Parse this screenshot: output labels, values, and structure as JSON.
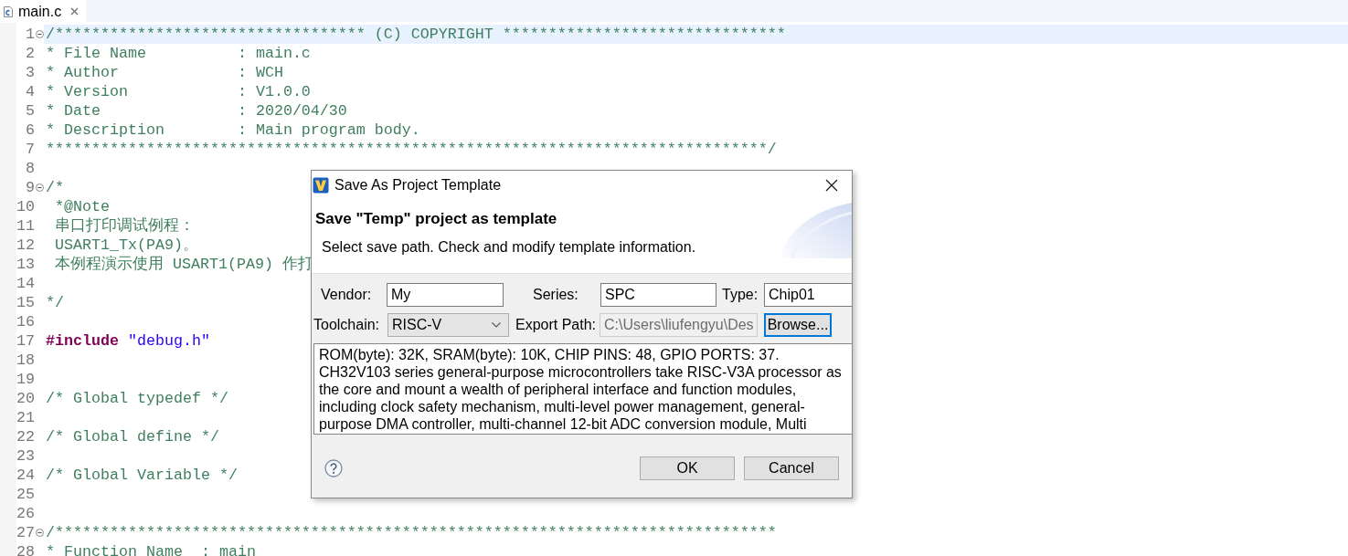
{
  "tabs": [
    {
      "label": "main.c",
      "selected": true
    }
  ],
  "editor": {
    "lines": [
      {
        "number": "1",
        "current": true,
        "collapsible": true,
        "segments": [
          {
            "kind": "comment",
            "text": "/********************************** (C) COPYRIGHT *******************************"
          }
        ]
      },
      {
        "number": "2",
        "current": false,
        "collapsible": false,
        "segments": [
          {
            "kind": "comment",
            "text": "* File Name          : main.c"
          }
        ]
      },
      {
        "number": "3",
        "current": false,
        "collapsible": false,
        "segments": [
          {
            "kind": "comment",
            "text": "* Author             : WCH"
          }
        ]
      },
      {
        "number": "4",
        "current": false,
        "collapsible": false,
        "segments": [
          {
            "kind": "comment",
            "text": "* Version            : V1.0.0"
          }
        ]
      },
      {
        "number": "5",
        "current": false,
        "collapsible": false,
        "segments": [
          {
            "kind": "comment",
            "text": "* Date               : 2020/04/30"
          }
        ]
      },
      {
        "number": "6",
        "current": false,
        "collapsible": false,
        "segments": [
          {
            "kind": "comment",
            "text": "* Description        : Main program body."
          }
        ]
      },
      {
        "number": "7",
        "current": false,
        "collapsible": false,
        "segments": [
          {
            "kind": "comment",
            "text": "*******************************************************************************/"
          }
        ]
      },
      {
        "number": "8",
        "current": false,
        "collapsible": false
      },
      {
        "number": "9",
        "current": false,
        "collapsible": true,
        "segments": [
          {
            "kind": "comment",
            "text": "/*"
          }
        ]
      },
      {
        "number": "10",
        "current": false,
        "collapsible": false,
        "segments": [
          {
            "kind": "comment",
            "text": " *@Note"
          }
        ]
      },
      {
        "number": "11",
        "current": false,
        "collapsible": false,
        "segments": [
          {
            "kind": "comment",
            "text": " 串口打印调试例程："
          }
        ]
      },
      {
        "number": "12",
        "current": false,
        "collapsible": false,
        "segments": [
          {
            "kind": "comment",
            "text": " USART1_Tx(PA9)。"
          }
        ]
      },
      {
        "number": "13",
        "current": false,
        "collapsible": false,
        "segments": [
          {
            "kind": "comment",
            "text": " 本例程演示使用 USART1(PA9) 作打"
          }
        ]
      },
      {
        "number": "14",
        "current": false,
        "collapsible": false
      },
      {
        "number": "15",
        "current": false,
        "collapsible": false,
        "segments": [
          {
            "kind": "comment",
            "text": "*/"
          }
        ]
      },
      {
        "number": "16",
        "current": false,
        "collapsible": false
      },
      {
        "number": "17",
        "current": false,
        "collapsible": false,
        "segments": [
          {
            "kind": "keyword",
            "text": "#include"
          },
          {
            "kind": "string",
            "text": " \"debug.h\""
          }
        ]
      },
      {
        "number": "18",
        "current": false,
        "collapsible": false
      },
      {
        "number": "19",
        "current": false,
        "collapsible": false
      },
      {
        "number": "20",
        "current": false,
        "collapsible": false,
        "segments": [
          {
            "kind": "comment",
            "text": "/* Global typedef */"
          }
        ]
      },
      {
        "number": "21",
        "current": false,
        "collapsible": false
      },
      {
        "number": "22",
        "current": false,
        "collapsible": false,
        "segments": [
          {
            "kind": "comment",
            "text": "/* Global define */"
          }
        ]
      },
      {
        "number": "23",
        "current": false,
        "collapsible": false
      },
      {
        "number": "24",
        "current": false,
        "collapsible": false,
        "segments": [
          {
            "kind": "comment",
            "text": "/* Global Variable */"
          }
        ]
      },
      {
        "number": "25",
        "current": false,
        "collapsible": false
      },
      {
        "number": "26",
        "current": false,
        "collapsible": false
      },
      {
        "number": "27",
        "current": false,
        "collapsible": true,
        "segments": [
          {
            "kind": "comment",
            "text": "/*******************************************************************************"
          }
        ]
      },
      {
        "number": "28",
        "current": false,
        "collapsible": false,
        "segments": [
          {
            "kind": "comment",
            "text": "* Function Name  : main"
          }
        ]
      }
    ]
  },
  "dialog": {
    "title": "Save As Project Template",
    "heading": "Save \"Temp\" project as template",
    "subtitle": "Select save path. Check and modify template information.",
    "fields_row_1": [
      {
        "kind": "text",
        "label": "Vendor:",
        "value": "My",
        "disabled": false
      },
      {
        "kind": "text",
        "label": "Series:",
        "value": "SPC",
        "disabled": false
      },
      {
        "kind": "text",
        "label": "Type:",
        "value": "Chip01",
        "disabled": false
      }
    ],
    "fields_row_2": [
      {
        "kind": "dropdown",
        "label": "Toolchain:",
        "value": "RISC-V",
        "disabled": false
      },
      {
        "kind": "text",
        "label": "Export Path:",
        "value": "C:\\Users\\liufengyu\\Des",
        "disabled": true
      }
    ],
    "browse_button": {
      "label": "Browse...",
      "focused": true
    },
    "description": [
      "ROM(byte): 32K, SRAM(byte): 10K, CHIP PINS: 48, GPIO PORTS: 37.",
      "CH32V103 series general-purpose microcontrollers take RISC-V3A processor as the core and mount a wealth of peripheral interface and function modules, including clock safety mechanism, multi-level power management, general-purpose DMA controller, multi-channel 12-bit ADC conversion module, Multi"
    ],
    "buttons": [
      {
        "label": "OK",
        "focused": false
      },
      {
        "label": "Cancel",
        "focused": false
      }
    ]
  }
}
